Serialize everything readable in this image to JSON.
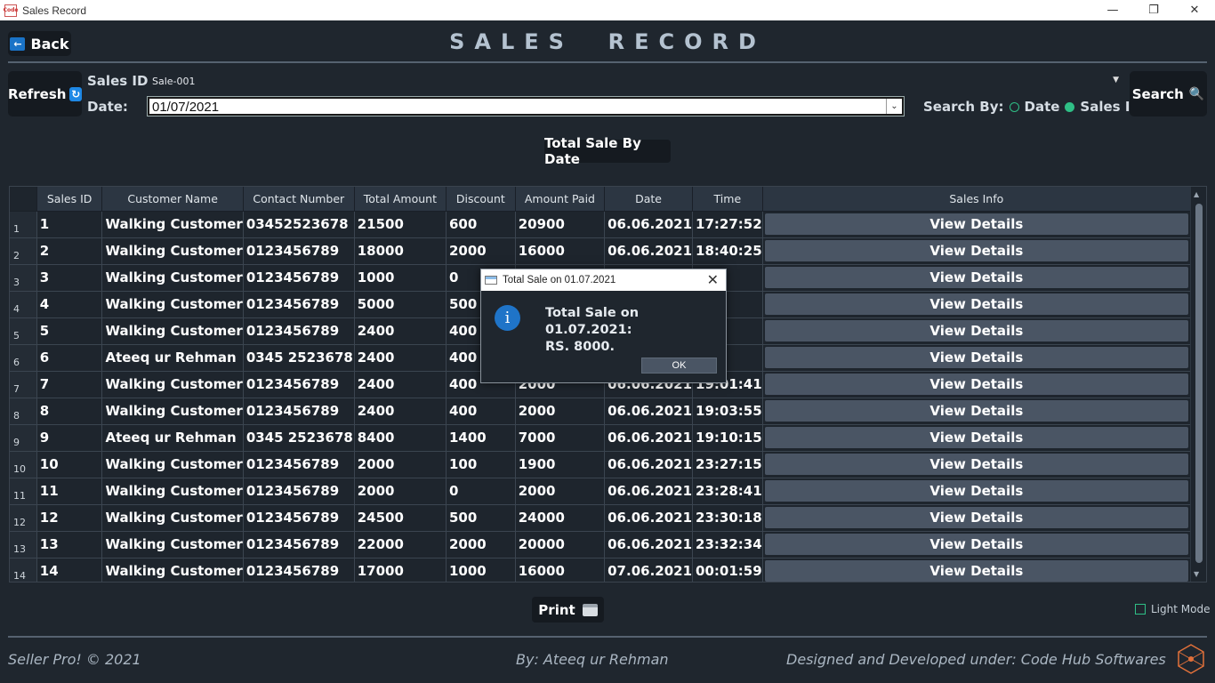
{
  "window": {
    "title": "Sales Record",
    "app_icon_label": "Code"
  },
  "header": {
    "back_label": "Back",
    "page_title": "SALES  RECORD"
  },
  "search": {
    "refresh_label": "Refresh",
    "sales_id_label": "Sales ID:",
    "sales_id_value": "Sale-001",
    "date_label": "Date:",
    "date_value": "01/07/2021",
    "search_by_label": "Search By:",
    "option_date": "Date",
    "option_sales_id": "Sales ID",
    "selected_option": "Sales ID",
    "search_label": "Search"
  },
  "total_sale_button": "Total Sale By Date",
  "table": {
    "columns": [
      "Sales ID",
      "Customer Name",
      "Contact Number",
      "Total Amount",
      "Discount",
      "Amount Paid",
      "Date",
      "Time",
      "Sales Info"
    ],
    "view_label": "View Details",
    "rows": [
      {
        "n": "1",
        "id": "1",
        "customer": "Walking Customer",
        "contact": "03452523678",
        "total": "21500",
        "discount": "600",
        "paid": "20900",
        "date": "06.06.2021",
        "time": "17:27:52"
      },
      {
        "n": "2",
        "id": "2",
        "customer": "Walking Customer",
        "contact": "0123456789",
        "total": "18000",
        "discount": "2000",
        "paid": "16000",
        "date": "06.06.2021",
        "time": "18:40:25"
      },
      {
        "n": "3",
        "id": "3",
        "customer": "Walking Customer",
        "contact": "0123456789",
        "total": "1000",
        "discount": "0",
        "paid": "",
        "date": "",
        "time": "37"
      },
      {
        "n": "4",
        "id": "4",
        "customer": "Walking Customer",
        "contact": "0123456789",
        "total": "5000",
        "discount": "500",
        "paid": "",
        "date": "",
        "time": "01"
      },
      {
        "n": "5",
        "id": "5",
        "customer": "Walking Customer",
        "contact": "0123456789",
        "total": "2400",
        "discount": "400",
        "paid": "",
        "date": "",
        "time": "21"
      },
      {
        "n": "6",
        "id": "6",
        "customer": "Ateeq ur Rehman",
        "contact": "0345 2523678",
        "total": "2400",
        "discount": "400",
        "paid": "",
        "date": "",
        "time": "00"
      },
      {
        "n": "7",
        "id": "7",
        "customer": "Walking Customer",
        "contact": "0123456789",
        "total": "2400",
        "discount": "400",
        "paid": "2000",
        "date": "06.06.2021",
        "time": "19:01:41"
      },
      {
        "n": "8",
        "id": "8",
        "customer": "Walking Customer",
        "contact": "0123456789",
        "total": "2400",
        "discount": "400",
        "paid": "2000",
        "date": "06.06.2021",
        "time": "19:03:55"
      },
      {
        "n": "9",
        "id": "9",
        "customer": "Ateeq ur Rehman",
        "contact": "0345 2523678",
        "total": "8400",
        "discount": "1400",
        "paid": "7000",
        "date": "06.06.2021",
        "time": "19:10:15"
      },
      {
        "n": "10",
        "id": "10",
        "customer": "Walking Customer",
        "contact": "0123456789",
        "total": "2000",
        "discount": "100",
        "paid": "1900",
        "date": "06.06.2021",
        "time": "23:27:15"
      },
      {
        "n": "11",
        "id": "11",
        "customer": "Walking Customer",
        "contact": "0123456789",
        "total": "2000",
        "discount": "0",
        "paid": "2000",
        "date": "06.06.2021",
        "time": "23:28:41"
      },
      {
        "n": "12",
        "id": "12",
        "customer": "Walking Customer",
        "contact": "0123456789",
        "total": "24500",
        "discount": "500",
        "paid": "24000",
        "date": "06.06.2021",
        "time": "23:30:18"
      },
      {
        "n": "13",
        "id": "13",
        "customer": "Walking Customer",
        "contact": "0123456789",
        "total": "22000",
        "discount": "2000",
        "paid": "20000",
        "date": "06.06.2021",
        "time": "23:32:34"
      },
      {
        "n": "14",
        "id": "14",
        "customer": "Walking Customer",
        "contact": "0123456789",
        "total": "17000",
        "discount": "1000",
        "paid": "16000",
        "date": "07.06.2021",
        "time": "00:01:59"
      }
    ]
  },
  "print_label": "Print",
  "light_mode_label": "Light Mode",
  "footer": {
    "left": "Seller Pro! © 2021",
    "center": "By: Ateeq ur Rehman",
    "right": "Designed and Developed under: Code Hub Softwares",
    "logo_text": "Code\nHub"
  },
  "dialog": {
    "title": "Total Sale on 01.07.2021",
    "message": "Total Sale on 01.07.2021:\nRS. 8000.",
    "ok_label": "OK"
  },
  "colors": {
    "background": "#1f262e",
    "button_dark": "#151a20",
    "accent_green": "#2fbf86",
    "accent_blue": "#1f74c8",
    "view_button": "#4a5564"
  }
}
